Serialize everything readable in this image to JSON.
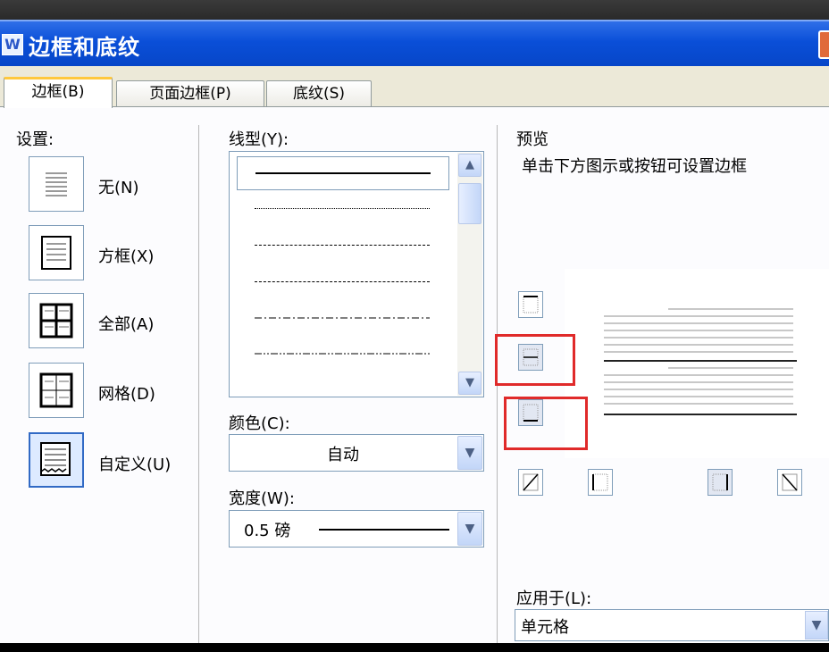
{
  "window": {
    "title": "边框和底纹"
  },
  "tabs": [
    {
      "label": "边框(B)",
      "active": true
    },
    {
      "label": "页面边框(P)",
      "active": false
    },
    {
      "label": "底纹(S)",
      "active": false
    }
  ],
  "settings": {
    "heading": "设置:",
    "items": [
      {
        "label": "无(N)",
        "icon": "border-none-icon"
      },
      {
        "label": "方框(X)",
        "icon": "border-box-icon"
      },
      {
        "label": "全部(A)",
        "icon": "border-all-icon"
      },
      {
        "label": "网格(D)",
        "icon": "border-grid-icon"
      },
      {
        "label": "自定义(U)",
        "icon": "border-custom-icon",
        "selected": true
      }
    ]
  },
  "line_style": {
    "heading": "线型(Y):",
    "styles": [
      "solid",
      "dotted",
      "dashed",
      "sparse-dash",
      "dash-dot",
      "dash-dot-dot"
    ],
    "selected_index": 0
  },
  "color": {
    "label": "颜色(C):",
    "value": "自动"
  },
  "width": {
    "label": "宽度(W):",
    "value": "0.5 磅"
  },
  "preview": {
    "heading": "预览",
    "hint": "单击下方图示或按钮可设置边框"
  },
  "apply_to": {
    "label": "应用于(L):",
    "value": "单元格"
  },
  "colors": {
    "titlebar": "#0a4fd8",
    "highlight_box": "#e02a2a",
    "tab_accent": "#ffc83c"
  }
}
